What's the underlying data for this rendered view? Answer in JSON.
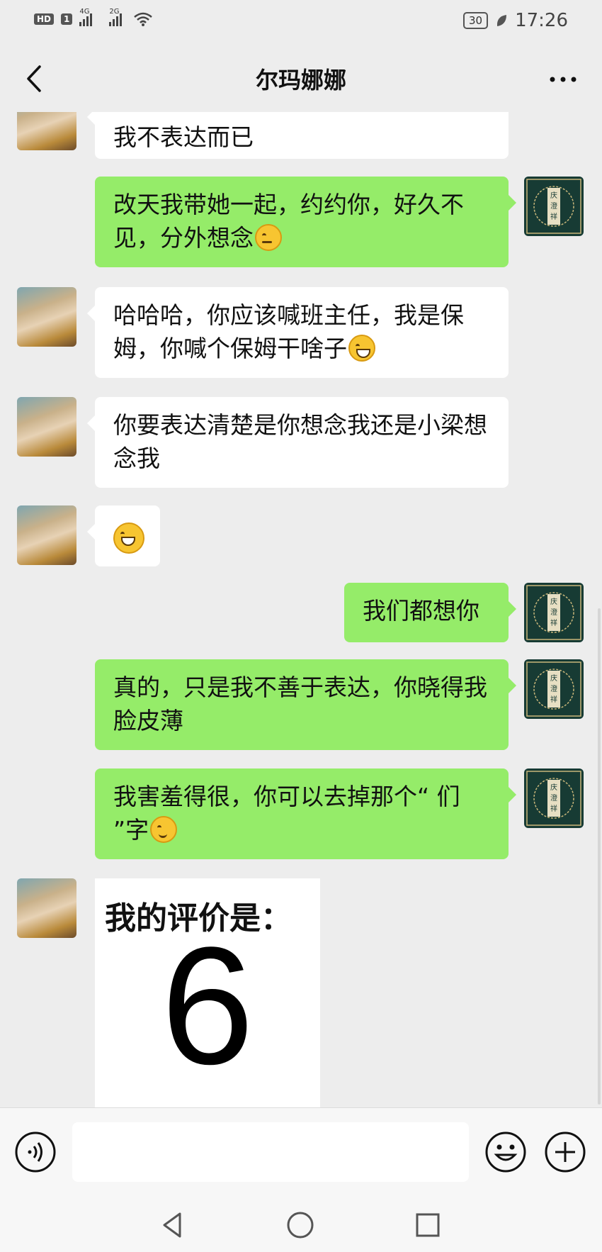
{
  "status_bar": {
    "hd_label": "HD",
    "sim_label": "1",
    "signal1_label": "4G",
    "signal2_label": "2G",
    "battery": "30",
    "time": "17:26"
  },
  "header": {
    "title": "尔玛娜娜"
  },
  "messages": [
    {
      "side": "in",
      "text": "我不表达而已",
      "emoji": ""
    },
    {
      "side": "out",
      "text": "改天我带她一起，约约你，好久不见，分外想念",
      "emoji": "thinking"
    },
    {
      "side": "in",
      "text": "哈哈哈，你应该喊班主任，我是保姆，你喊个保姆干啥子",
      "emoji": "grin"
    },
    {
      "side": "in",
      "text": "你要表达清楚是你想念我还是小梁想念我",
      "emoji": ""
    },
    {
      "side": "in",
      "text": "",
      "emoji": "grin"
    },
    {
      "side": "out",
      "text": "我们都想你",
      "emoji": ""
    },
    {
      "side": "out",
      "text": "真的，只是我不善于表达，你晓得我脸皮薄",
      "emoji": ""
    },
    {
      "side": "out",
      "text": "我害羞得很，你可以去掉那个“ 们 ”字",
      "emoji": "shy"
    }
  ],
  "image_message": {
    "title": "我的评价是：",
    "number": "6"
  },
  "avatar_sticker": {
    "text": "庆澄祥"
  },
  "input_bar": {
    "placeholder": ""
  },
  "colors": {
    "outgoing_bubble": "#95ec69",
    "incoming_bubble": "#ffffff",
    "background": "#ededed"
  }
}
